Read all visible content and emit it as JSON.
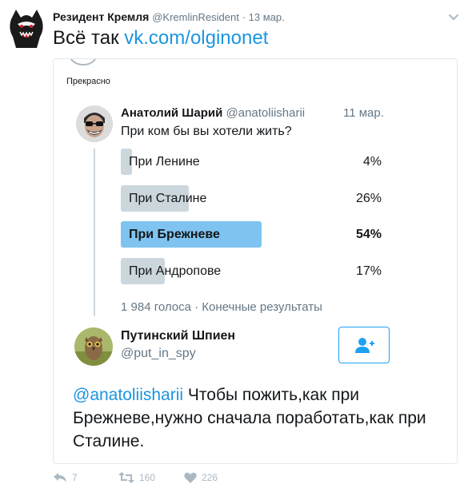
{
  "outer_tweet": {
    "author_name": "Резидент Кремля",
    "author_handle": "@KremlinResident",
    "time": "· 13 мар.",
    "text_prefix": "Всё так ",
    "text_link": "vk.com/olginonet"
  },
  "card": {
    "caption": "Прекрасно",
    "poll_tweet": {
      "author_name": "Анатолий Шарий",
      "author_handle": "@anatoliisharii",
      "time": "11 мар.",
      "question": "При ком бы вы хотели жить?",
      "options": [
        {
          "label": "При Ленине",
          "percent": "4%",
          "value": 4,
          "winner": false
        },
        {
          "label": "При Сталине",
          "percent": "26%",
          "value": 26,
          "winner": false
        },
        {
          "label": "При Брежневе",
          "percent": "54%",
          "value": 54,
          "winner": true
        },
        {
          "label": "При Андропове",
          "percent": "17%",
          "value": 17,
          "winner": false
        }
      ],
      "footer": "1 984 голоса · Конечные результаты"
    },
    "reply": {
      "author_name": "Путинский Шпиен",
      "author_handle": "@put_in_spy",
      "mention": "@anatoliisharii",
      "text": " Чтобы пожить,как при Брежневе,нужно сначала поработать,как при Сталине."
    }
  },
  "actions": {
    "replies": "7",
    "retweets": "160",
    "likes": "226"
  },
  "icons": {
    "follow": "follow-user-icon",
    "reply": "reply-icon",
    "retweet": "retweet-icon",
    "like": "heart-icon",
    "more": "chevron-down-icon"
  },
  "colors": {
    "link": "#1b95e0",
    "poll_winner": "#7fc4f0",
    "poll_bar": "#ccd6dd",
    "muted": "#657786"
  }
}
